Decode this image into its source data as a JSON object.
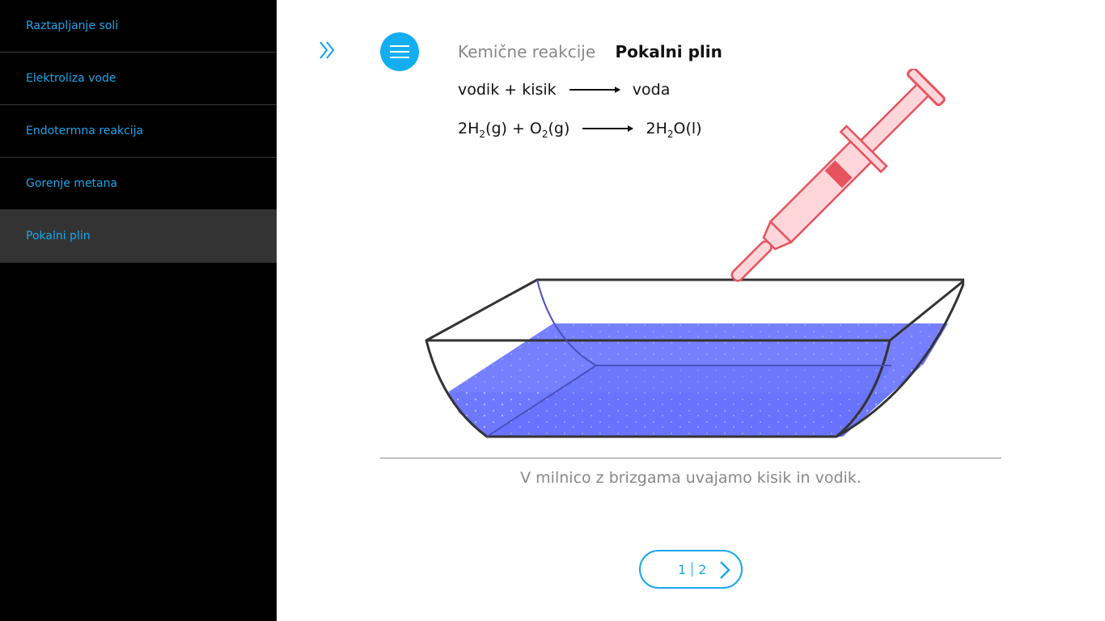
{
  "sidebar": {
    "items": [
      {
        "label": "Raztapljanje soli"
      },
      {
        "label": "Elektroliza vode"
      },
      {
        "label": "Endotermna reakcija"
      },
      {
        "label": "Gorenje metana"
      },
      {
        "label": "Pokalni plin"
      }
    ],
    "active_index": 4
  },
  "header": {
    "section": "Kemične reakcije",
    "topic": "Pokalni plin",
    "expand_icon": "double-chevron-right-icon",
    "menu_icon": "hamburger-icon"
  },
  "equations": {
    "word": {
      "left": "vodik + kisik",
      "right": "voda"
    },
    "formula": {
      "l1": "2H",
      "l1_sub": "2",
      "l2": "(g) + O",
      "l2_sub": "2",
      "l3": "(g)",
      "r1": "2H",
      "r1_sub": "2",
      "r2": "O(l)"
    }
  },
  "caption": "V milnico z brizgama uvajamo kisik in vodik.",
  "pager": {
    "current": "1",
    "total": "2",
    "next_icon": "chevron-right-icon"
  },
  "colors": {
    "accent": "#12aef1",
    "water": "#6e78ff",
    "syringe": "#e8525e",
    "syringe_fill": "#ffd7db",
    "sidebar_bg": "#000000",
    "sidebar_active": "#333333"
  }
}
